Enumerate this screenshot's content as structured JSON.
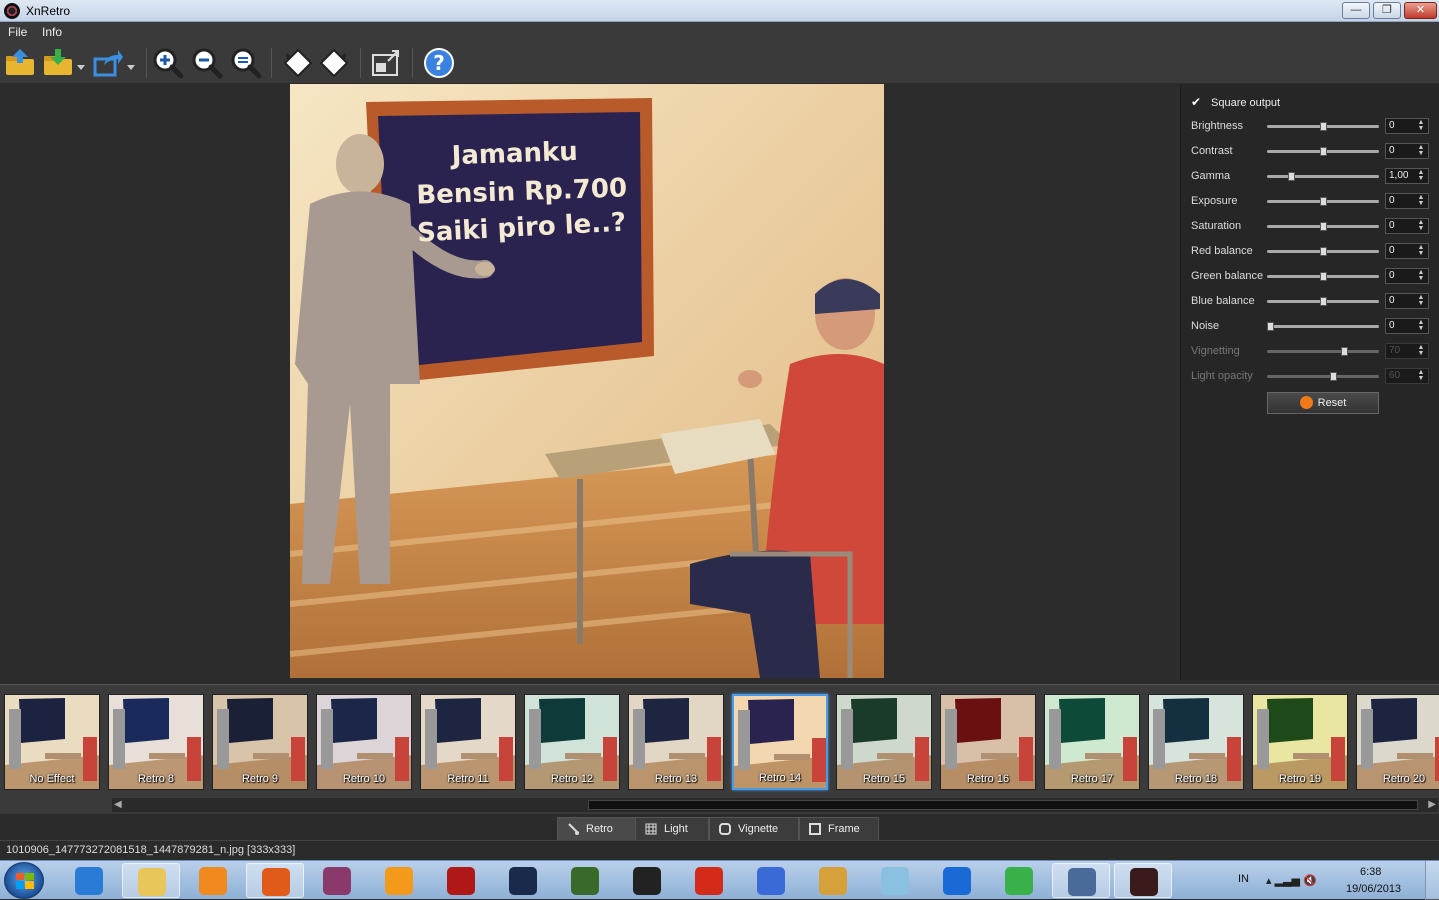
{
  "window": {
    "title": "XnRetro",
    "minimize": "—",
    "maximize": "❐",
    "close": "✕"
  },
  "menu": {
    "file": "File",
    "info": "Info"
  },
  "panel": {
    "square_output_label": "Square output",
    "square_output_checked": true,
    "adjustments": [
      {
        "label": "Brightness",
        "value": "0",
        "level": 0.5,
        "enabled": true
      },
      {
        "label": "Contrast",
        "value": "0",
        "level": 0.5,
        "enabled": true
      },
      {
        "label": "Gamma",
        "value": "1,00",
        "level": 0.2,
        "enabled": true
      },
      {
        "label": "Exposure",
        "value": "0",
        "level": 0.5,
        "enabled": true
      },
      {
        "label": "Saturation",
        "value": "0",
        "level": 0.5,
        "enabled": true
      },
      {
        "label": "Red balance",
        "value": "0",
        "level": 0.5,
        "enabled": true
      },
      {
        "label": "Green balance",
        "value": "0",
        "level": 0.5,
        "enabled": true
      },
      {
        "label": "Blue balance",
        "value": "0",
        "level": 0.5,
        "enabled": true
      },
      {
        "label": "Noise",
        "value": "0",
        "level": 0.0,
        "enabled": true
      },
      {
        "label": "Vignetting",
        "value": "70",
        "level": 0.7,
        "enabled": false
      },
      {
        "label": "Light opacity",
        "value": "60",
        "level": 0.6,
        "enabled": false
      }
    ],
    "reset_label": "Reset"
  },
  "preview": {
    "board_lines": [
      "Jamanku",
      "Bensin Rp.700",
      "Saiki piro le..?"
    ]
  },
  "filmstrip": {
    "items": [
      {
        "label": "No Effect",
        "tint": "#e9dcc0",
        "board": "#1c2340",
        "selected": false
      },
      {
        "label": "Retro 8",
        "tint": "#e8e0d8",
        "board": "#1a2a5a",
        "selected": false
      },
      {
        "label": "Retro 9",
        "tint": "#d8c4a8",
        "board": "#1a2036",
        "selected": false
      },
      {
        "label": "Retro 10",
        "tint": "#ddd4d8",
        "board": "#1c2648",
        "selected": false
      },
      {
        "label": "Retro 11",
        "tint": "#e4d9c8",
        "board": "#1d2540",
        "selected": false
      },
      {
        "label": "Retro 12",
        "tint": "#cfe3d8",
        "board": "#0f3a3a",
        "selected": false
      },
      {
        "label": "Retro 13",
        "tint": "#e2d6c4",
        "board": "#1d2540",
        "selected": false
      },
      {
        "label": "Retro 14",
        "tint": "#f2d7b0",
        "board": "#2a2350",
        "selected": true
      },
      {
        "label": "Retro 15",
        "tint": "#cfd8cc",
        "board": "#1a3a2a",
        "selected": false
      },
      {
        "label": "Retro 16",
        "tint": "#d8c0a8",
        "board": "#6a1010",
        "selected": false
      },
      {
        "label": "Retro 17",
        "tint": "#cfe8d0",
        "board": "#0d4a3a",
        "selected": false
      },
      {
        "label": "Retro 18",
        "tint": "#d6e4dc",
        "board": "#143040",
        "selected": false
      },
      {
        "label": "Retro 19",
        "tint": "#e8e6a0",
        "board": "#1e4a1a",
        "selected": false
      },
      {
        "label": "Retro 20",
        "tint": "#ddd8cc",
        "board": "#1c2440",
        "selected": false
      }
    ]
  },
  "tabs": [
    {
      "label": "Retro",
      "icon": "brush-icon",
      "active": true
    },
    {
      "label": "Light",
      "icon": "light-icon",
      "active": false
    },
    {
      "label": "Vignette",
      "icon": "vignette-icon",
      "active": false
    },
    {
      "label": "Frame",
      "icon": "frame-icon",
      "active": false
    }
  ],
  "status": {
    "file": "1010906_147773272081518_1447879281_n.jpg [333x333]"
  },
  "taskbar": {
    "apps": [
      {
        "name": "ie",
        "color": "#2a7bd6"
      },
      {
        "name": "explorer",
        "color": "#e8c65a"
      },
      {
        "name": "media-player",
        "color": "#f08a1e"
      },
      {
        "name": "firefox",
        "color": "#e05a1a"
      },
      {
        "name": "winrar",
        "color": "#8a3a6a"
      },
      {
        "name": "orange-app",
        "color": "#f39a1a"
      },
      {
        "name": "skull-app-1",
        "color": "#b01818"
      },
      {
        "name": "skull-app-2",
        "color": "#1a2a4a"
      },
      {
        "name": "terminal-app",
        "color": "#3a6a2a"
      },
      {
        "name": "tf-app",
        "color": "#222222"
      },
      {
        "name": "stop-app",
        "color": "#d42a1a"
      },
      {
        "name": "network-app",
        "color": "#3a6ad6"
      },
      {
        "name": "paint-app",
        "color": "#d6a03a"
      },
      {
        "name": "notes-app",
        "color": "#8ac0e0"
      },
      {
        "name": "teamviewer",
        "color": "#1a6ad6"
      },
      {
        "name": "globe-app",
        "color": "#3ab04a"
      },
      {
        "name": "search-app",
        "color": "#4a6a9a"
      },
      {
        "name": "xnretro-app",
        "color": "#3a1a1a"
      }
    ],
    "lang": "IN",
    "time": "6:38",
    "date": "19/06/2013"
  }
}
